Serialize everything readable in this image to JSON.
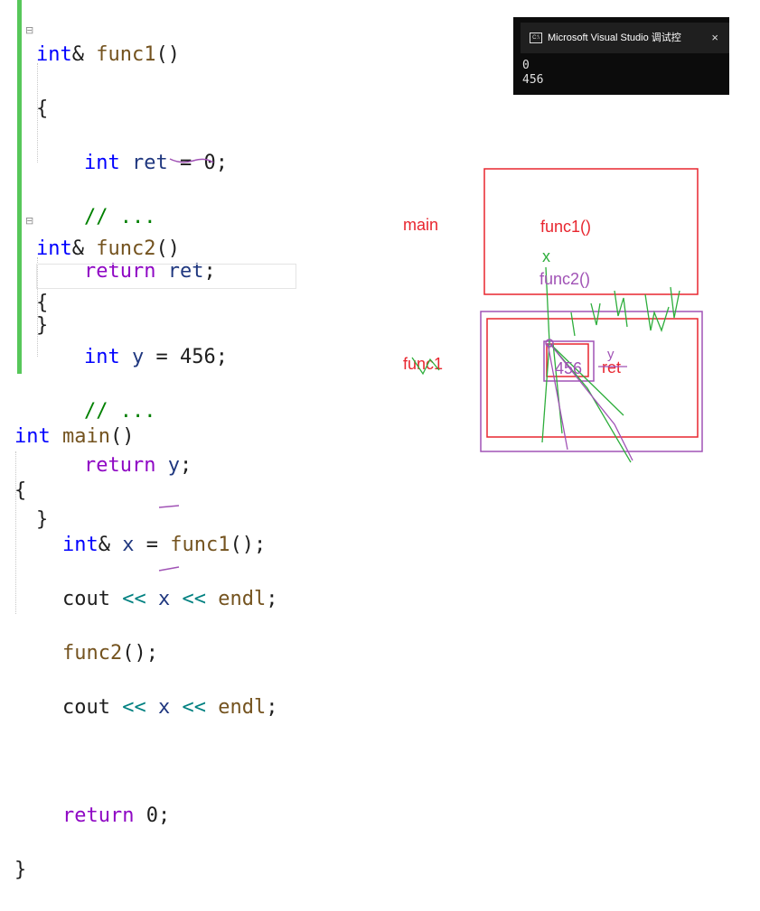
{
  "code": {
    "func1": {
      "ret_type": "int",
      "amp": "&",
      "name": "func1",
      "parens": "()",
      "open": "{",
      "decl_type": "int",
      "decl_var": "ret",
      "decl_rest": " = 0;",
      "comment": "// ...",
      "ret_kw": "return",
      "ret_var": "ret",
      "semi": ";",
      "close": "}"
    },
    "func2": {
      "ret_type": "int",
      "amp": "&",
      "name": "func2",
      "parens": "()",
      "open": "{",
      "decl_type": "int",
      "decl_var": "y",
      "decl_rest": " = 456;",
      "comment": "// ...",
      "ret_kw": "return",
      "ret_var": "y",
      "semi": ";",
      "close": "}"
    },
    "main": {
      "ret_type": "int",
      "name": "main",
      "parens": "()",
      "open": "{",
      "l1_type": "int",
      "l1_amp": "&",
      "l1_var": "x",
      "l1_eq": " = ",
      "l1_call": "func1",
      "l1_end": "();",
      "cout": "cout",
      "shl": "<<",
      "x": "x",
      "endl": "endl",
      "semi": ";",
      "call2": "func2",
      "call2_end": "();",
      "ret_kw": "return",
      "ret_val": " 0;",
      "close": "}"
    }
  },
  "console": {
    "title": "Microsoft Visual Studio 调试控",
    "close_glyph": "×",
    "icon": "console-window-icon",
    "lines": [
      "0",
      "456"
    ]
  },
  "diagram": {
    "label_main": "main",
    "label_func1_call": "func1()",
    "label_x": "x",
    "label_func2_call": "func2()",
    "label_func1_frame": "func1",
    "label_y": "y",
    "label_ret": "ret",
    "label_value": "456",
    "colors": {
      "red": "#e8262f",
      "purple": "#a052b5",
      "green": "#2eae3c"
    }
  }
}
